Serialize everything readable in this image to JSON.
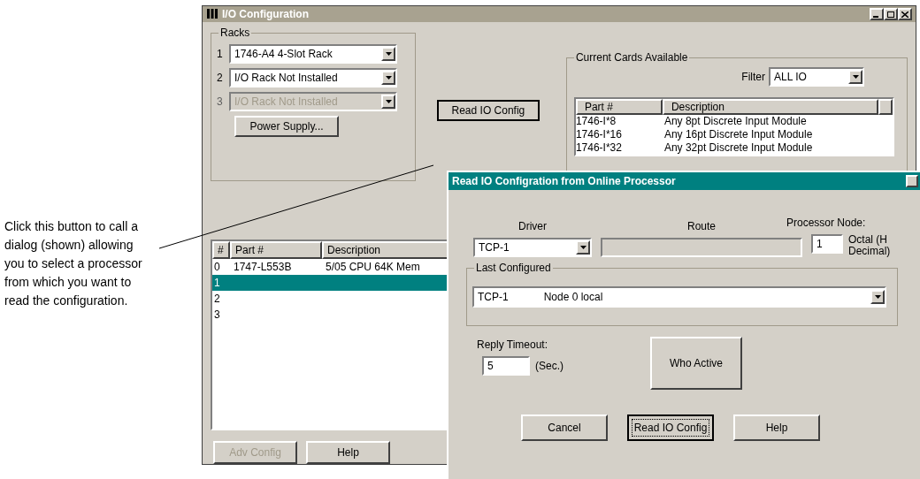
{
  "annotation": "Click this button to call a dialog (shown) allowing you to select a processor from which you want to read the configuration.",
  "main_window": {
    "title": "I/O Configuration",
    "racks": {
      "label": "Racks",
      "items": [
        {
          "number": "1",
          "value": "1746-A4 4-Slot Rack",
          "disabled": false
        },
        {
          "number": "2",
          "value": "I/O Rack Not Installed",
          "disabled": false
        },
        {
          "number": "3",
          "value": "I/O Rack Not Installed",
          "disabled": true
        }
      ]
    },
    "power_supply_button": "Power Supply...",
    "read_button": "Read IO Config",
    "cards": {
      "label": "Current Cards Available",
      "filter_label": "Filter",
      "filter_value": "ALL IO",
      "columns": [
        "Part #",
        "Description"
      ],
      "rows": [
        [
          "1746-I*8",
          "Any 8pt Discrete Input Module"
        ],
        [
          "1746-I*16",
          "Any 16pt Discrete Input Module"
        ],
        [
          "1746-I*32",
          "Any 32pt Discrete Input Module"
        ]
      ]
    },
    "rack_table": {
      "columns": [
        "#",
        "Part #",
        "Description"
      ],
      "rows": [
        {
          "cells": [
            "0",
            "1747-L553B",
            "5/05 CPU   64K Mem"
          ],
          "selected": false
        },
        {
          "cells": [
            "1"
          ],
          "selected": true
        },
        {
          "cells": [
            "2"
          ],
          "selected": false
        },
        {
          "cells": [
            "3"
          ],
          "selected": false
        }
      ]
    },
    "buttons": [
      {
        "label": "Adv Config",
        "disabled": true
      },
      {
        "label": "Help",
        "disabled": false
      }
    ]
  },
  "dialog": {
    "title": "Read IO Configration from Online Processor",
    "driver_label": "Driver",
    "driver_value": "TCP-1",
    "route_label": "Route",
    "node_label": "Processor Node:",
    "node_value": "1",
    "node_notes": [
      "Octal (H",
      "Decimal)"
    ],
    "last_configured": {
      "label": "Last Configured",
      "driver": "TCP-1",
      "node": "Node 0 local"
    },
    "timeout_label": "Reply Timeout:",
    "timeout_value": "5",
    "timeout_unit": "(Sec.)",
    "who_active": "Who Active",
    "buttons": [
      {
        "label": "Cancel",
        "default": false
      },
      {
        "label": "Read IO Config",
        "default": true
      },
      {
        "label": "Help",
        "default": false
      }
    ]
  }
}
